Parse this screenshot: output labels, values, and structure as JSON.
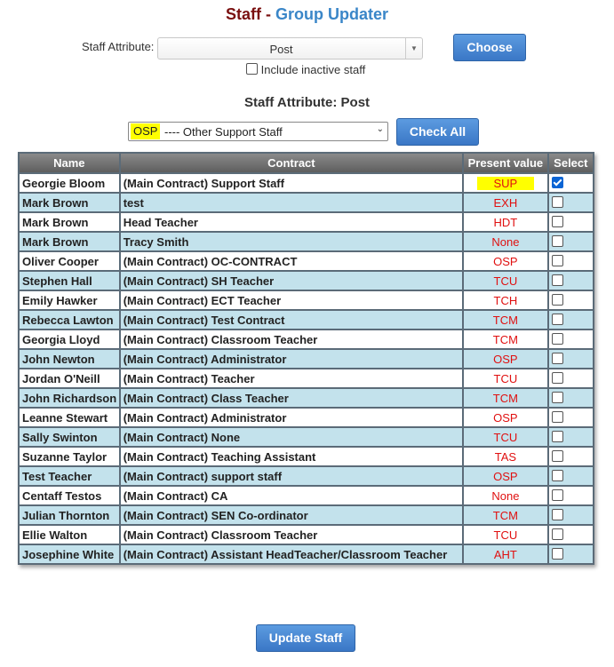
{
  "header": {
    "title_part1": "Staff - ",
    "title_part2": "Group Updater"
  },
  "attribute_chooser": {
    "label": "Staff Attribute:",
    "selected": "Post",
    "choose_label": "Choose",
    "include_inactive_label": "Include inactive staff",
    "include_inactive_checked": false
  },
  "subheading": "Staff Attribute: Post",
  "value_selector": {
    "code": "OSP",
    "description": "---- Other Support Staff"
  },
  "check_all_label": "Check All",
  "table": {
    "columns": [
      "Name",
      "Contract",
      "Present value",
      "Select"
    ],
    "rows": [
      {
        "name": "Georgie Bloom",
        "contract": "(Main Contract) Support Staff",
        "value": "SUP",
        "checked": true,
        "highlight": true
      },
      {
        "name": "Mark Brown",
        "contract": "test",
        "value": "EXH",
        "checked": false
      },
      {
        "name": "Mark Brown",
        "contract": "Head Teacher",
        "value": "HDT",
        "checked": false
      },
      {
        "name": "Mark Brown",
        "contract": "Tracy Smith",
        "value": "None",
        "checked": false
      },
      {
        "name": "Oliver Cooper",
        "contract": "(Main Contract) OC-CONTRACT",
        "value": "OSP",
        "checked": false
      },
      {
        "name": "Stephen Hall",
        "contract": "(Main Contract) SH Teacher",
        "value": "TCU",
        "checked": false
      },
      {
        "name": "Emily Hawker",
        "contract": "(Main Contract) ECT Teacher",
        "value": "TCH",
        "checked": false
      },
      {
        "name": "Rebecca Lawton",
        "contract": "(Main Contract) Test Contract",
        "value": "TCM",
        "checked": false
      },
      {
        "name": "Georgia Lloyd",
        "contract": "(Main Contract) Classroom Teacher",
        "value": "TCM",
        "checked": false
      },
      {
        "name": "John Newton",
        "contract": "(Main Contract) Administrator",
        "value": "OSP",
        "checked": false
      },
      {
        "name": "Jordan O'Neill",
        "contract": "(Main Contract) Teacher",
        "value": "TCU",
        "checked": false
      },
      {
        "name": "John Richardson",
        "contract": "(Main Contract) Class Teacher",
        "value": "TCM",
        "checked": false
      },
      {
        "name": "Leanne Stewart",
        "contract": "(Main Contract) Administrator",
        "value": "OSP",
        "checked": false
      },
      {
        "name": "Sally Swinton",
        "contract": "(Main Contract) None",
        "value": "TCU",
        "checked": false
      },
      {
        "name": "Suzanne Taylor",
        "contract": "(Main Contract) Teaching Assistant",
        "value": "TAS",
        "checked": false
      },
      {
        "name": "Test Teacher",
        "contract": "(Main Contract) support staff",
        "value": "OSP",
        "checked": false
      },
      {
        "name": "Centaff Testos",
        "contract": "(Main Contract) CA",
        "value": "None",
        "checked": false
      },
      {
        "name": "Julian Thornton",
        "contract": "(Main Contract) SEN Co-ordinator",
        "value": "TCM",
        "checked": false
      },
      {
        "name": "Ellie Walton",
        "contract": "(Main Contract) Classroom Teacher",
        "value": "TCU",
        "checked": false
      },
      {
        "name": "Josephine White",
        "contract": "(Main Contract) Assistant HeadTeacher/Classroom Teacher",
        "value": "AHT",
        "checked": false
      }
    ]
  },
  "update_label": "Update Staff",
  "colors": {
    "title_dark": "#7a1010",
    "title_accent": "#3a86c8",
    "value_red": "#e01010",
    "highlight": "#ffff00",
    "row_alt": "#c3e2ec"
  }
}
